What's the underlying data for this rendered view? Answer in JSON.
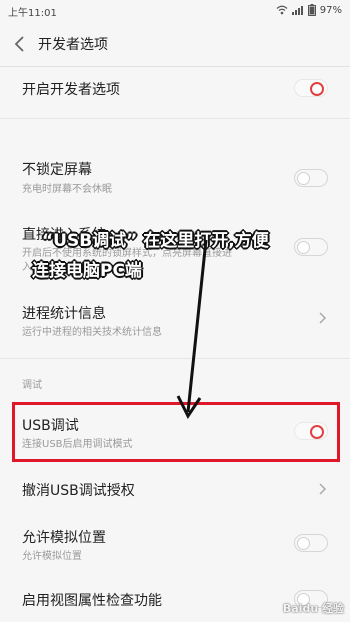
{
  "status_bar": {
    "time": "上午11:01",
    "battery": "97%"
  },
  "header": {
    "title": "开发者选项"
  },
  "rows": [
    {
      "label": "开启开发者选项",
      "toggle": "on"
    },
    {
      "label": "不锁定屏幕",
      "sub": "充电时屏幕不会休眠",
      "toggle": "off"
    },
    {
      "label": "直接进入系统",
      "sub1": "开启后不使用系统的锁屏样式，点亮屏幕直接进",
      "sub2": "入系统",
      "toggle": "off"
    },
    {
      "label": "进程统计信息",
      "sub": "运行中进程的相关技术统计信息"
    },
    {
      "label": "USB调试",
      "sub": "连接USB后启用调试模式",
      "toggle": "on"
    },
    {
      "label": "撤消USB调试授权"
    },
    {
      "label": "允许模拟位置",
      "sub": "允许模拟位置",
      "toggle": "off"
    },
    {
      "label": "启用视图属性检查功能",
      "toggle": "off"
    }
  ],
  "section_debug": "调试",
  "annotation": {
    "line1": "“USB调试” 在这里打开,方便",
    "line2": "连接电脑PC端"
  },
  "colors": {
    "accent": "#e24040",
    "highlight_border": "#e0162b"
  },
  "watermark": "Baidu 经验"
}
